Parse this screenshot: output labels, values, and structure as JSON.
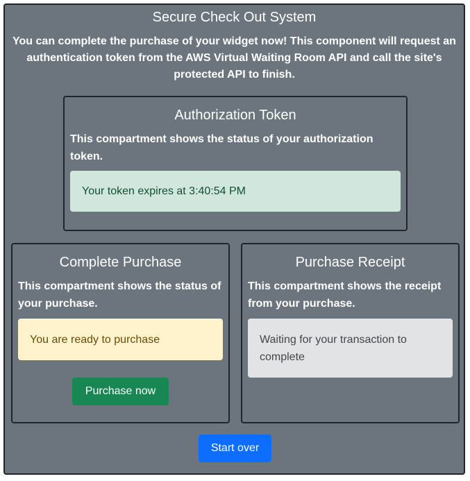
{
  "main": {
    "title": "Secure Check Out System",
    "description": "You can complete the purchase of your widget now! This component will request an authentication token from the AWS Virtual Waiting Room API and call the site's protected API to finish."
  },
  "auth": {
    "title": "Authorization Token",
    "description": "This compartment shows the status of your authorization token.",
    "status": "Your token expires at 3:40:54 PM"
  },
  "purchase": {
    "title": "Complete Purchase",
    "description": "This compartment shows the status of your purchase.",
    "status": "You are ready to purchase",
    "button_label": "Purchase now"
  },
  "receipt": {
    "title": "Purchase Receipt",
    "description": "This compartment shows the receipt from your purchase.",
    "status": "Waiting for your transaction to complete"
  },
  "footer": {
    "start_over_label": "Start over"
  },
  "colors": {
    "panel_bg": "#6c757d",
    "success_alert_bg": "#d1e7dd",
    "success_alert_text": "#0f5132",
    "warning_alert_bg": "#fff3cd",
    "warning_alert_text": "#664d03",
    "secondary_alert_bg": "#e2e3e5",
    "secondary_alert_text": "#41464b",
    "success_button": "#198754",
    "primary_button": "#0d6efd"
  }
}
